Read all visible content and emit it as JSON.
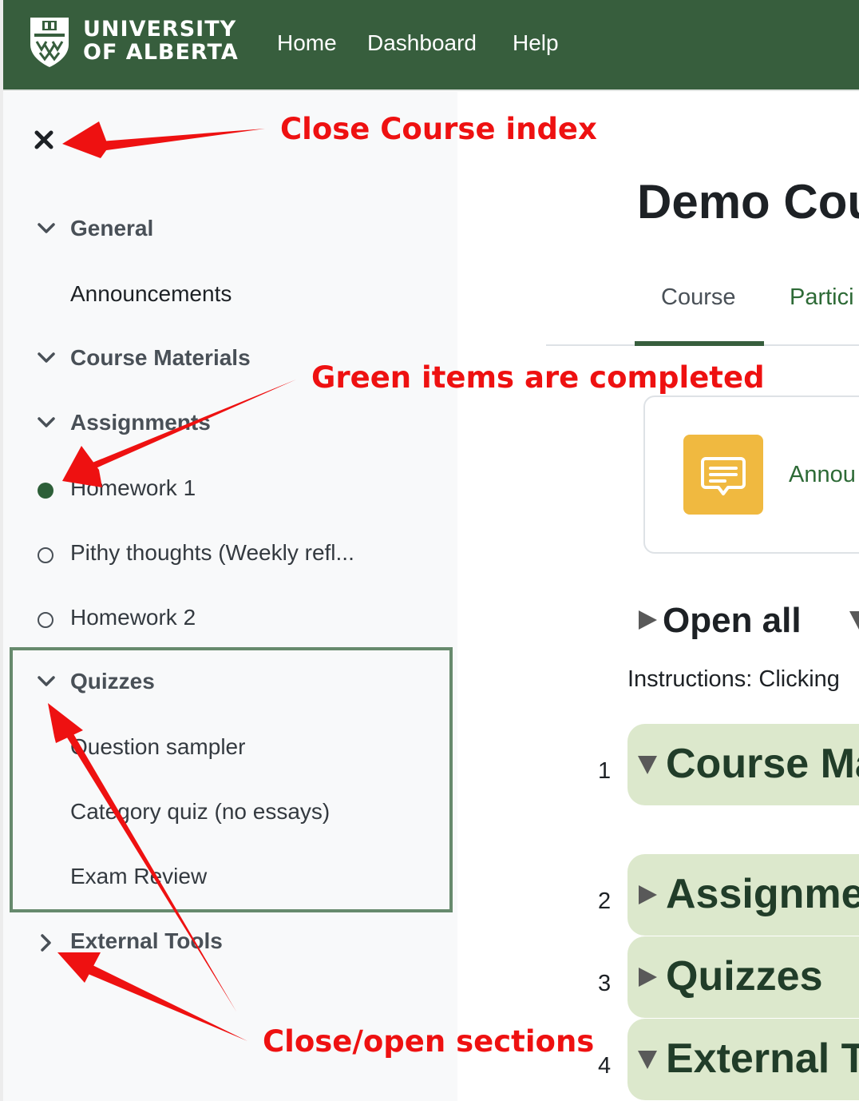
{
  "header": {
    "brand_line1": "UNIVERSITY",
    "brand_line2": "OF ALBERTA",
    "nav": [
      "Home",
      "Dashboard",
      "Help"
    ],
    "bg_color": "#375e3d"
  },
  "course_index": {
    "close_icon": "close-icon",
    "sections": [
      {
        "label": "General",
        "expanded": true
      },
      {
        "label": "Course Materials",
        "expanded": true
      },
      {
        "label": "Assignments",
        "expanded": true
      },
      {
        "label": "Quizzes",
        "expanded": true
      },
      {
        "label": "External Tools",
        "expanded": false
      }
    ],
    "items": {
      "announcements": "Announcements",
      "homework1": "Homework 1",
      "pithy": "Pithy thoughts (Weekly refl...",
      "homework2": "Homework 2",
      "question_sampler": "Question sampler",
      "category_quiz": "Category quiz (no essays)",
      "exam_review": "Exam Review"
    },
    "completion": {
      "homework1": "completed",
      "pithy": "not-completed",
      "homework2": "not-completed"
    },
    "completed_color": "#2d5f38"
  },
  "main": {
    "course_title": "Demo Cou",
    "tabs": [
      "Course",
      "Partici"
    ],
    "announcement_card": "Annou",
    "open_all": "Open all",
    "instructions": "Instructions: Clicking",
    "sections": [
      {
        "num": "1",
        "title": "Course Ma",
        "expanded": true
      },
      {
        "num": "2",
        "title": "Assignme",
        "expanded": false
      },
      {
        "num": "3",
        "title": "Quizzes",
        "expanded": false
      },
      {
        "num": "4",
        "title": "External T",
        "expanded": true
      }
    ]
  },
  "annotations": {
    "close_course_index": "Close Course index",
    "green_items": "Green items are completed",
    "close_open_sections": "Close/open sections",
    "color": "#ee1111"
  }
}
